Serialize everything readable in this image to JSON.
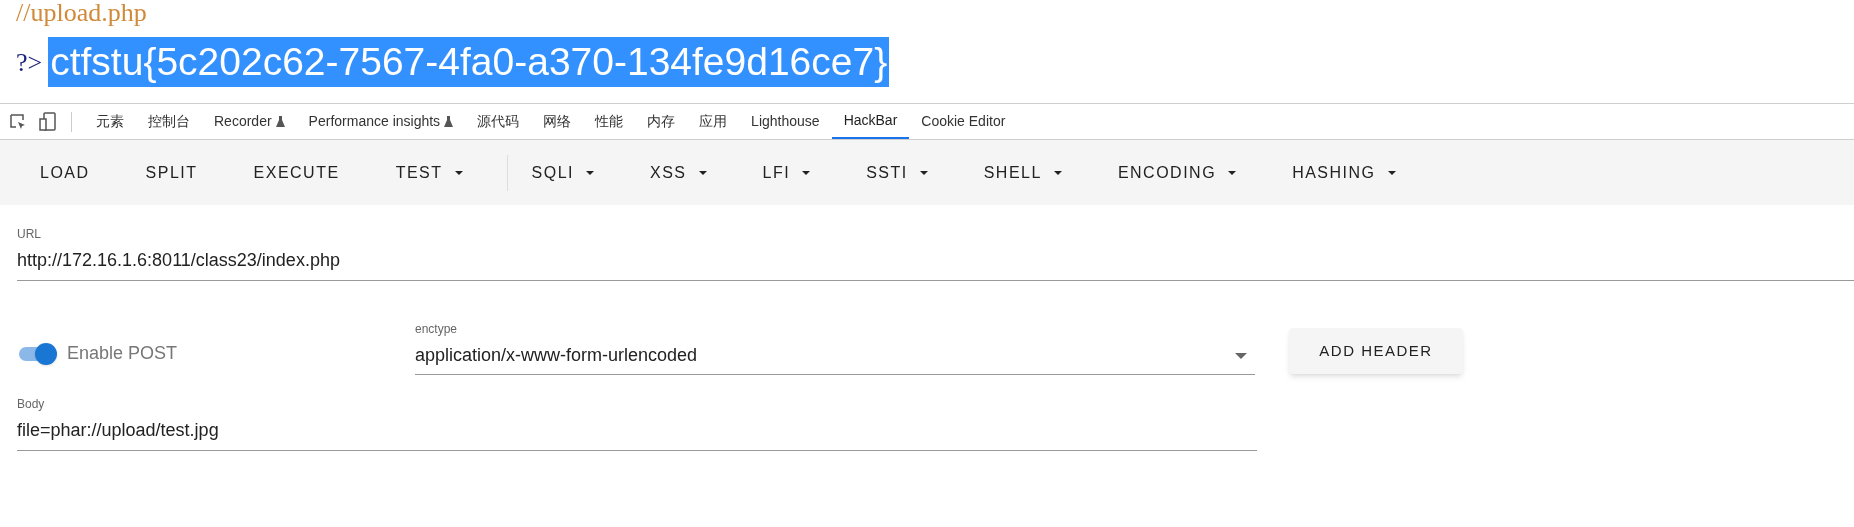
{
  "source": {
    "comment": "//upload.php",
    "close_tag": "?>",
    "output": "ctfstu{5c202c62-7567-4fa0-a370-134fe9d16ce7}",
    "output_selected": true
  },
  "devtools_tabs": [
    {
      "label": "元素",
      "selected": false,
      "flask": false
    },
    {
      "label": "控制台",
      "selected": false,
      "flask": false
    },
    {
      "label": "Recorder",
      "selected": false,
      "flask": true
    },
    {
      "label": "Performance insights",
      "selected": false,
      "flask": true
    },
    {
      "label": "源代码",
      "selected": false,
      "flask": false
    },
    {
      "label": "网络",
      "selected": false,
      "flask": false
    },
    {
      "label": "性能",
      "selected": false,
      "flask": false
    },
    {
      "label": "内存",
      "selected": false,
      "flask": false
    },
    {
      "label": "应用",
      "selected": false,
      "flask": false
    },
    {
      "label": "Lighthouse",
      "selected": false,
      "flask": false
    },
    {
      "label": "HackBar",
      "selected": true,
      "flask": false
    },
    {
      "label": "Cookie Editor",
      "selected": false,
      "flask": false
    }
  ],
  "toolbar": [
    [
      {
        "label": "LOAD",
        "dropdown": false
      },
      {
        "label": "SPLIT",
        "dropdown": false
      },
      {
        "label": "EXECUTE",
        "dropdown": false
      },
      {
        "label": "TEST",
        "dropdown": true
      }
    ],
    [
      {
        "label": "SQLI",
        "dropdown": true
      },
      {
        "label": "XSS",
        "dropdown": true
      },
      {
        "label": "LFI",
        "dropdown": true
      },
      {
        "label": "SSTI",
        "dropdown": true
      },
      {
        "label": "SHELL",
        "dropdown": true
      },
      {
        "label": "ENCODING",
        "dropdown": true
      },
      {
        "label": "HASHING",
        "dropdown": true
      }
    ]
  ],
  "url": {
    "label": "URL",
    "value": "http://172.16.1.6:8011/class23/index.php"
  },
  "enable_post": {
    "label": "Enable POST",
    "on": true
  },
  "enctype": {
    "label": "enctype",
    "value": "application/x-www-form-urlencoded"
  },
  "add_header": "ADD HEADER",
  "body": {
    "label": "Body",
    "value": "file=phar://upload/test.jpg"
  }
}
